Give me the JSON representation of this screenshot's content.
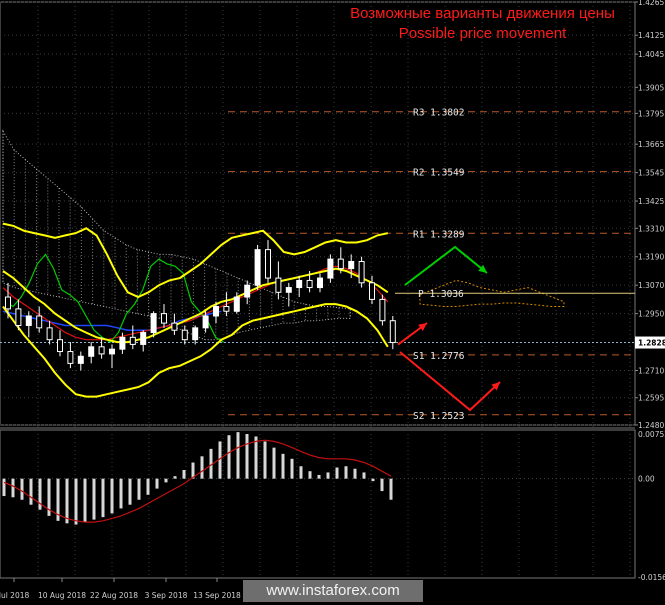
{
  "title_ru": "Возможные варианты движения цены",
  "title_en": "Possible price movement",
  "watermark": "www.instaforex.com",
  "colors": {
    "background": "#000000",
    "candle_up": "#ffffff",
    "candle_down": "#000000",
    "bollinger": "#ffff00",
    "fast_ma": "#00cc00",
    "slow_ma": "#1e46ff",
    "red_ma": "#e01010",
    "ichimoku_cloud": "#d8d8d8",
    "ichimoku_cloud_future": "#d48a00",
    "level_line": "#b85a2a",
    "pivot_line": "#e0c878",
    "current_price_line": "#8ab8d0",
    "arrow_up": "#00d000",
    "arrow_down": "#ff1a1a",
    "macd_hist": "#d8d8d8",
    "macd_signal": "#c01010",
    "grid": "#3a3a3a"
  },
  "chart_data": {
    "type": "candlestick",
    "ylim": [
      1.248,
      1.4265
    ],
    "y_ticks": [
      "1.4265",
      "1.4125",
      "1.4045",
      "1.3905",
      "1.3795",
      "1.3665",
      "1.3545",
      "1.3425",
      "1.3310",
      "1.3190",
      "1.3070",
      "1.2950",
      "1.2710",
      "1.2595",
      "1.2480"
    ],
    "x_ticks": [
      "Jul 2018",
      "10 Aug 2018",
      "22 Aug 2018",
      "3 Sep 2018",
      "13 Sep 2018"
    ],
    "current_price": "1.2828",
    "levels": [
      {
        "name": "R3",
        "value": "1.3802"
      },
      {
        "name": "R2",
        "value": "1.3549"
      },
      {
        "name": "R1",
        "value": "1.3289"
      },
      {
        "name": "P",
        "value": "1.3036"
      },
      {
        "name": "S1",
        "value": "1.2776"
      },
      {
        "name": "S2",
        "value": "1.2523"
      }
    ],
    "candles": [
      {
        "o": 1.302,
        "h": 1.308,
        "l": 1.293,
        "c": 1.297
      },
      {
        "o": 1.297,
        "h": 1.301,
        "l": 1.288,
        "c": 1.29
      },
      {
        "o": 1.29,
        "h": 1.296,
        "l": 1.285,
        "c": 1.294
      },
      {
        "o": 1.294,
        "h": 1.298,
        "l": 1.287,
        "c": 1.289
      },
      {
        "o": 1.289,
        "h": 1.292,
        "l": 1.282,
        "c": 1.284
      },
      {
        "o": 1.284,
        "h": 1.288,
        "l": 1.277,
        "c": 1.279
      },
      {
        "o": 1.279,
        "h": 1.283,
        "l": 1.272,
        "c": 1.274
      },
      {
        "o": 1.274,
        "h": 1.279,
        "l": 1.271,
        "c": 1.277
      },
      {
        "o": 1.277,
        "h": 1.283,
        "l": 1.274,
        "c": 1.281
      },
      {
        "o": 1.281,
        "h": 1.285,
        "l": 1.276,
        "c": 1.278
      },
      {
        "o": 1.278,
        "h": 1.282,
        "l": 1.272,
        "c": 1.28
      },
      {
        "o": 1.28,
        "h": 1.287,
        "l": 1.278,
        "c": 1.285
      },
      {
        "o": 1.285,
        "h": 1.29,
        "l": 1.28,
        "c": 1.282
      },
      {
        "o": 1.282,
        "h": 1.288,
        "l": 1.279,
        "c": 1.287
      },
      {
        "o": 1.287,
        "h": 1.296,
        "l": 1.285,
        "c": 1.295
      },
      {
        "o": 1.295,
        "h": 1.299,
        "l": 1.289,
        "c": 1.291
      },
      {
        "o": 1.291,
        "h": 1.295,
        "l": 1.286,
        "c": 1.288
      },
      {
        "o": 1.288,
        "h": 1.29,
        "l": 1.282,
        "c": 1.284
      },
      {
        "o": 1.284,
        "h": 1.29,
        "l": 1.282,
        "c": 1.289
      },
      {
        "o": 1.289,
        "h": 1.296,
        "l": 1.287,
        "c": 1.294
      },
      {
        "o": 1.294,
        "h": 1.3,
        "l": 1.291,
        "c": 1.298
      },
      {
        "o": 1.298,
        "h": 1.304,
        "l": 1.294,
        "c": 1.296
      },
      {
        "o": 1.296,
        "h": 1.304,
        "l": 1.295,
        "c": 1.302
      },
      {
        "o": 1.302,
        "h": 1.309,
        "l": 1.299,
        "c": 1.307
      },
      {
        "o": 1.307,
        "h": 1.324,
        "l": 1.305,
        "c": 1.322
      },
      {
        "o": 1.322,
        "h": 1.326,
        "l": 1.308,
        "c": 1.31
      },
      {
        "o": 1.31,
        "h": 1.317,
        "l": 1.301,
        "c": 1.304
      },
      {
        "o": 1.304,
        "h": 1.308,
        "l": 1.298,
        "c": 1.306
      },
      {
        "o": 1.306,
        "h": 1.311,
        "l": 1.302,
        "c": 1.309
      },
      {
        "o": 1.309,
        "h": 1.313,
        "l": 1.304,
        "c": 1.306
      },
      {
        "o": 1.306,
        "h": 1.312,
        "l": 1.304,
        "c": 1.31
      },
      {
        "o": 1.31,
        "h": 1.32,
        "l": 1.308,
        "c": 1.318
      },
      {
        "o": 1.318,
        "h": 1.323,
        "l": 1.312,
        "c": 1.314
      },
      {
        "o": 1.314,
        "h": 1.32,
        "l": 1.31,
        "c": 1.317
      },
      {
        "o": 1.317,
        "h": 1.319,
        "l": 1.306,
        "c": 1.308
      },
      {
        "o": 1.308,
        "h": 1.311,
        "l": 1.299,
        "c": 1.301
      },
      {
        "o": 1.301,
        "h": 1.303,
        "l": 1.29,
        "c": 1.292
      },
      {
        "o": 1.292,
        "h": 1.294,
        "l": 1.28,
        "c": 1.2828
      }
    ],
    "bollinger_upper": [
      1.333,
      1.332,
      1.33,
      1.329,
      1.328,
      1.327,
      1.328,
      1.329,
      1.331,
      1.328,
      1.32,
      1.311,
      1.304,
      1.302,
      1.304,
      1.307,
      1.309,
      1.31,
      1.313,
      1.316,
      1.32,
      1.324,
      1.327,
      1.328,
      1.329,
      1.33,
      1.326,
      1.321,
      1.32,
      1.321,
      1.323,
      1.325,
      1.326,
      1.325,
      1.325,
      1.326,
      1.328,
      1.329
    ],
    "bollinger_middle": [
      1.313,
      1.31,
      1.306,
      1.302,
      1.299,
      1.295,
      1.292,
      1.289,
      1.287,
      1.285,
      1.284,
      1.283,
      1.283,
      1.284,
      1.285,
      1.287,
      1.289,
      1.291,
      1.293,
      1.295,
      1.298,
      1.3,
      1.301,
      1.303,
      1.305,
      1.307,
      1.308,
      1.309,
      1.31,
      1.311,
      1.312,
      1.313,
      1.314,
      1.313,
      1.311,
      1.309,
      1.307,
      1.304
    ],
    "bollinger_lower": [
      1.298,
      1.292,
      1.286,
      1.281,
      1.276,
      1.27,
      1.265,
      1.261,
      1.26,
      1.26,
      1.261,
      1.262,
      1.263,
      1.264,
      1.266,
      1.27,
      1.272,
      1.273,
      1.275,
      1.277,
      1.28,
      1.284,
      1.286,
      1.29,
      1.292,
      1.293,
      1.294,
      1.295,
      1.296,
      1.297,
      1.298,
      1.299,
      1.299,
      1.298,
      1.296,
      1.293,
      1.288,
      1.281
    ],
    "red_ma": [
      1.306,
      1.302,
      1.299,
      1.296,
      1.293,
      1.29,
      1.287,
      1.285,
      1.284,
      1.284,
      1.284,
      1.285,
      1.286,
      1.287,
      1.288,
      1.289,
      1.29,
      1.291,
      1.292,
      1.294,
      1.296,
      1.298,
      1.3,
      1.302,
      1.304,
      1.306,
      1.308,
      1.309,
      1.31,
      1.311,
      1.312,
      1.314,
      1.315,
      1.314,
      1.312,
      1.309,
      1.305,
      1.3
    ],
    "blue_ma": [
      1.296,
      1.295,
      1.294,
      1.293,
      1.292,
      1.291,
      1.29,
      1.29,
      1.29,
      1.29,
      1.29,
      1.289,
      1.288,
      1.288,
      1.288,
      1.289,
      1.29,
      1.292,
      1.293,
      1.294,
      1.295,
      1.296
    ],
    "green_ma": [
      1.3,
      1.298,
      1.302,
      1.308,
      1.316,
      1.32,
      1.314,
      1.305,
      1.303,
      1.3,
      1.294,
      1.288,
      1.285,
      1.283,
      1.287,
      1.295,
      1.299,
      1.305,
      1.315,
      1.318,
      1.316,
      1.315,
      1.312,
      1.3,
      1.296,
      1.292,
      1.285,
      1.283
    ],
    "macd_histogram": [
      -0.0028,
      -0.003,
      -0.0034,
      -0.0042,
      -0.005,
      -0.006,
      -0.0068,
      -0.0072,
      -0.0074,
      -0.007,
      -0.0066,
      -0.0062,
      -0.0056,
      -0.0048,
      -0.0042,
      -0.0034,
      -0.0026,
      -0.0016,
      -0.0006,
      0.0004,
      0.0014,
      0.0026,
      0.0036,
      0.0048,
      0.006,
      0.007,
      0.0075,
      0.0072,
      0.0068,
      0.006,
      0.005,
      0.004,
      0.0032,
      0.002,
      0.0012,
      0.0006,
      0.001,
      0.0018,
      0.002,
      0.0016,
      0.001,
      -0.0004,
      -0.002,
      -0.0034
    ],
    "macd_signal": [
      -0.0006,
      -0.0012,
      -0.002,
      -0.003,
      -0.004,
      -0.005,
      -0.0058,
      -0.0064,
      -0.0068,
      -0.007,
      -0.007,
      -0.0068,
      -0.0064,
      -0.006,
      -0.0054,
      -0.0048,
      -0.004,
      -0.0032,
      -0.0024,
      -0.0016,
      -0.0008,
      0.0002,
      0.0012,
      0.0022,
      0.0032,
      0.0042,
      0.005,
      0.0056,
      0.006,
      0.0062,
      0.006,
      0.0056,
      0.005,
      0.0044,
      0.0038,
      0.0034,
      0.0032,
      0.0032,
      0.0032,
      0.003,
      0.0026,
      0.002,
      0.0012,
      0.0004
    ],
    "macd_axis_labels": [
      "0.00752",
      "0.00",
      "-0.01569"
    ],
    "macd_ylim": [
      -0.01569,
      0.00752
    ]
  }
}
